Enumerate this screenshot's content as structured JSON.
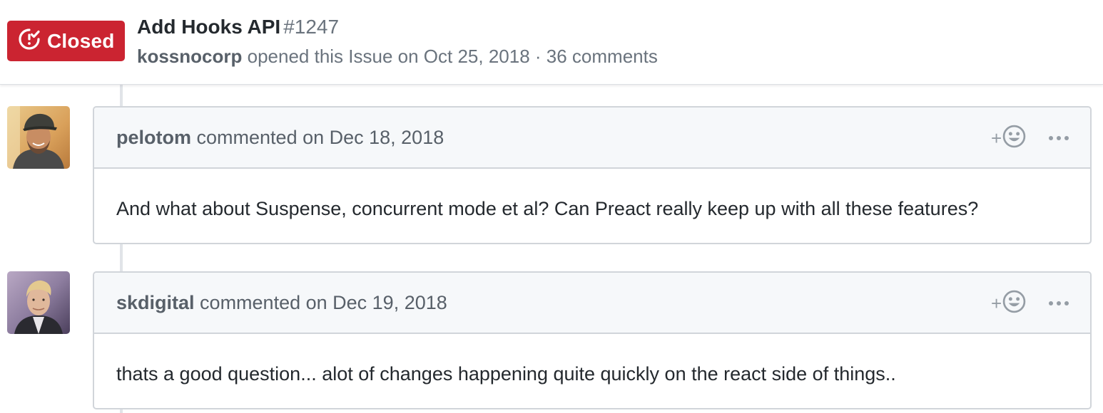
{
  "issue": {
    "state_icon": "issue-closed-icon",
    "state": "Closed",
    "title": "Add Hooks API",
    "number": "#1247",
    "author": "kossnocorp",
    "meta_text": "opened this Issue on Oct 25, 2018 · 36 comments"
  },
  "comments": [
    {
      "author": "pelotom",
      "action_text": "commented on Dec 18, 2018",
      "body": "And what about Suspense, concurrent mode et al? Can Preact really keep up with all these features?",
      "reaction_plus": "+",
      "reaction_icon": "smiley-icon",
      "more_icon": "kebab-horizontal-icon"
    },
    {
      "author": "skdigital",
      "action_text": "commented on Dec 19, 2018",
      "body": "thats a good question... alot of changes happening quite quickly on the react side of things..",
      "reaction_plus": "+",
      "reaction_icon": "smiley-icon",
      "more_icon": "kebab-horizontal-icon"
    }
  ],
  "colors": {
    "closed_red": "#cb2431",
    "meta_gray": "#6a737d",
    "header_bg": "#f6f8fa",
    "border": "#d1d5da"
  }
}
